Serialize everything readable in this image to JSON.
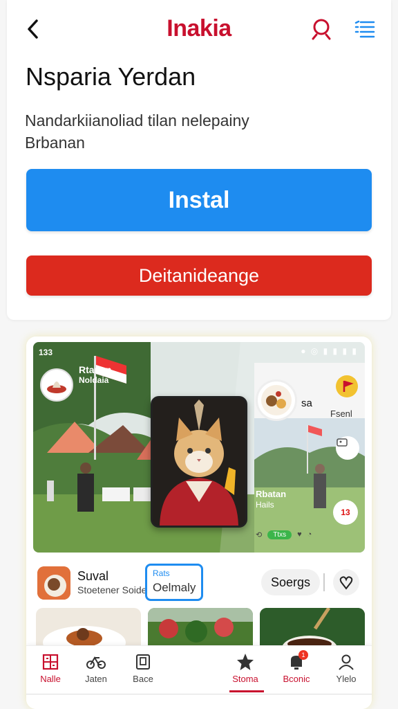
{
  "header": {
    "brand": "Inakia",
    "back_icon": "chevron-left-icon",
    "search_icon": "search-icon",
    "menu_icon": "list-menu-icon",
    "brand_color": "#c8102e"
  },
  "listing": {
    "title": "Nsparia Yerdan",
    "subtitle_line1": "Nandarkiianoliad tilan nelepainy",
    "subtitle_line2": "Brbanan",
    "install_label": "Instal",
    "secondary_label": "Deitanideange",
    "install_color": "#1e8cf0",
    "secondary_color": "#dc2a1e"
  },
  "preview": {
    "status_time": "133",
    "hero_chip": "Rtanan",
    "hero_chip2": "Noldaia",
    "right_label": "sa",
    "right_label2": "Fsenl",
    "inner_text1": "Rbatan",
    "inner_text2": "Hails",
    "inner_pill": "Ttxs",
    "badge_count": "13"
  },
  "app_row": {
    "name": "Suval",
    "sub": "Stoetener Soide",
    "rating_line1": "Rats",
    "rating_line2": "Oelmaly",
    "save_label": "Soergs"
  },
  "bottom_nav": {
    "items": [
      {
        "label": "Nalle",
        "icon": "home-grid-icon",
        "active": false
      },
      {
        "label": "Jaten",
        "icon": "bicycle-icon",
        "active": false
      },
      {
        "label": "Bace",
        "icon": "device-icon",
        "active": false
      },
      {
        "label": "Stoma",
        "icon": "star-icon",
        "active": true
      },
      {
        "label": "Bconic",
        "icon": "notification-icon",
        "active": false
      },
      {
        "label": "Ylelo",
        "icon": "profile-icon",
        "active": false
      }
    ],
    "notification_badge": "1"
  }
}
